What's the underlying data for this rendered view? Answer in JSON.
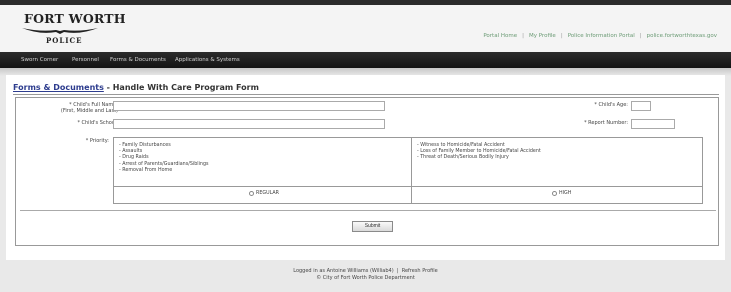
{
  "header": {
    "logo_line1": "FORT WORTH",
    "logo_line2": "POLICE",
    "links": [
      "Portal Home",
      "My Profile",
      "Police Information Portal",
      "police.fortworthtexas.gov"
    ]
  },
  "nav": {
    "items": [
      "Sworn Corner",
      "Personnel",
      "Forms & Documents",
      "Applications & Systems"
    ]
  },
  "page": {
    "breadcrumb": "Forms & Documents",
    "title_suffix": " - Handle With Care Program Form"
  },
  "form": {
    "childs_name_label": "* Child's Full Name:",
    "childs_name_sublabel": "(First, Middle and Last)",
    "childs_name_value": "",
    "childs_age_label": "* Child's Age:",
    "childs_age_value": "",
    "childs_school_label": "* Child's School:",
    "childs_school_value": "",
    "report_number_label": "* Report Number:",
    "report_number_value": "",
    "priority_label": "* Priority:",
    "regular_items": [
      "- Family Disturbances",
      "- Assaults",
      "- Drug Raids",
      "- Arrest of Parents/Guardians/Siblings",
      "- Removal From Home"
    ],
    "high_items": [
      "- Witness to Homicide/Fatal Accident",
      "- Loss of Family Member to Homicide/Fatal Accident",
      "- Threat of Death/Serious Bodily Injury"
    ],
    "regular_option": "REGULAR",
    "high_option": "HIGH",
    "submit_label": "Submit"
  },
  "footer": {
    "logged_in": "Logged in as Antoine Williams (Williab4)",
    "refresh": "Refresh Profile",
    "copyright": "© City of Fort Worth Police Department"
  }
}
